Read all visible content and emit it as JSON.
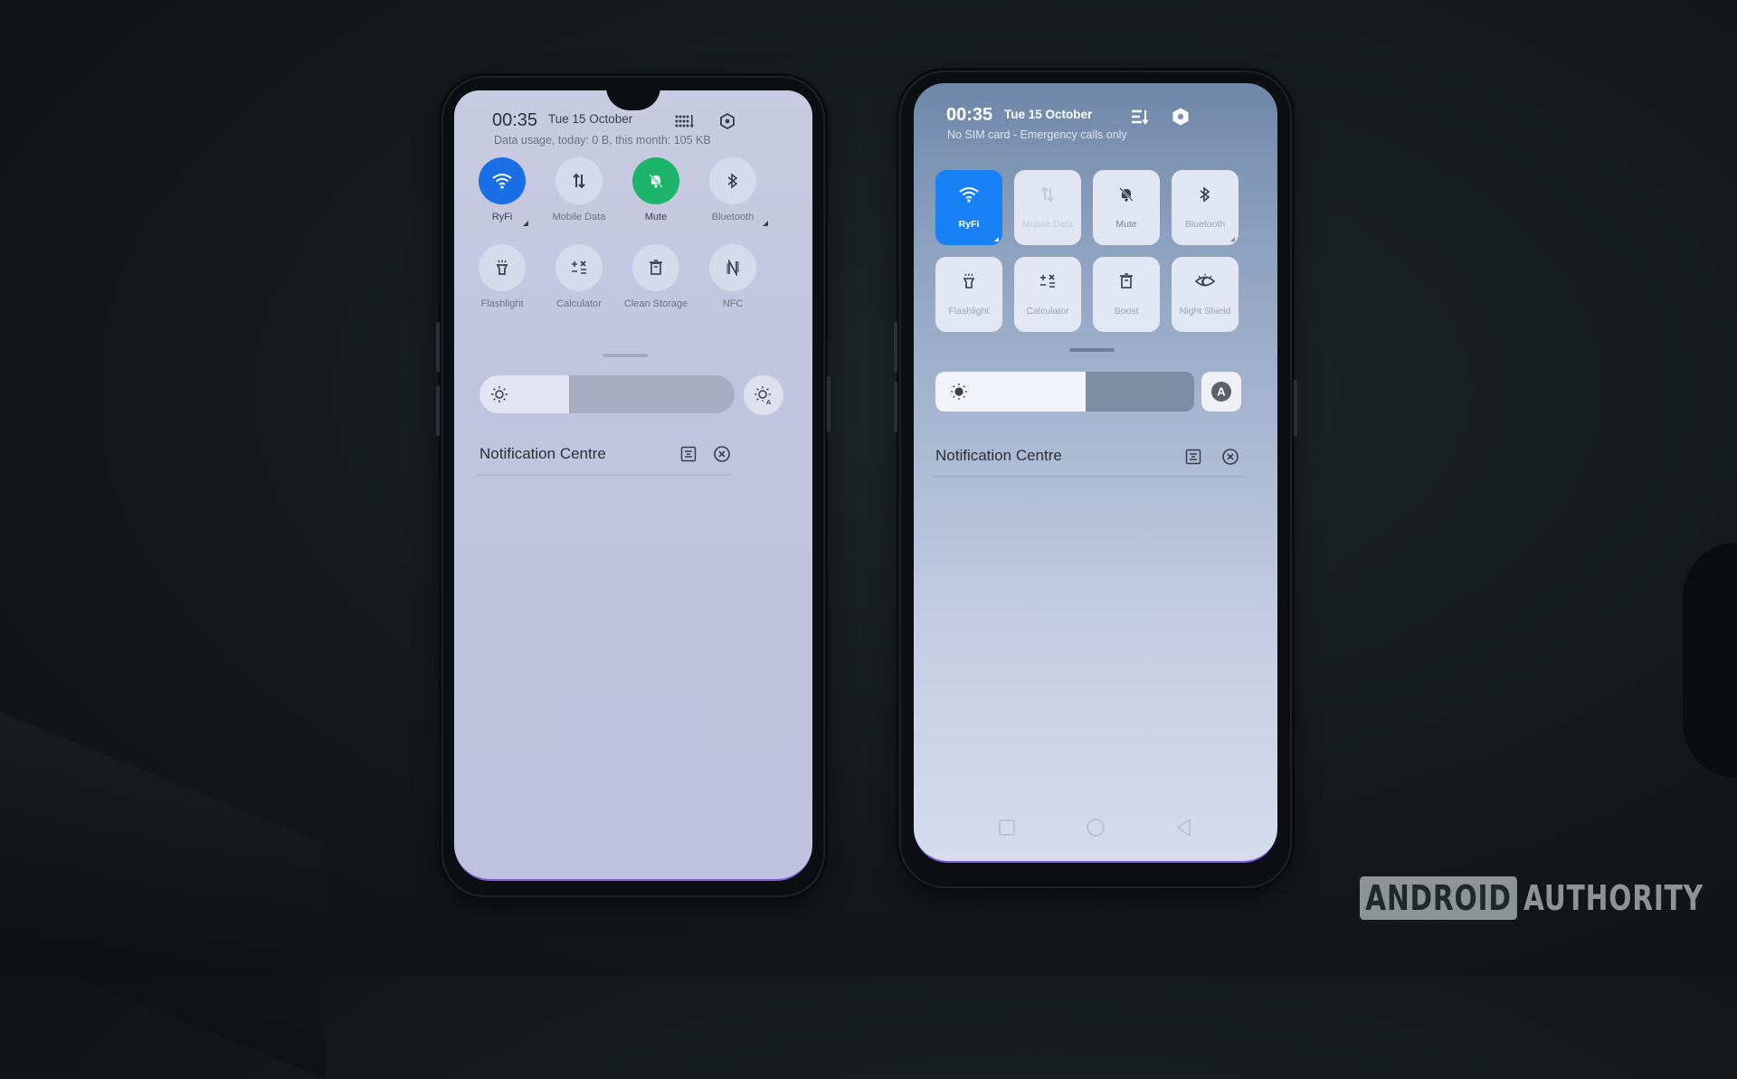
{
  "left_phone": {
    "status": {
      "time": "00:35",
      "date": "Tue 15 October",
      "subtitle": "Data usage, today: 0 B, this month: 105 KB",
      "icons": [
        "grid-edit-icon",
        "settings-icon"
      ]
    },
    "quick_tiles": [
      {
        "label": "RyFi",
        "icon": "wifi-icon",
        "state": "on",
        "color": "#1a6fe6",
        "has_expand": true
      },
      {
        "label": "Mobile Data",
        "icon": "mobile-data-icon",
        "state": "off",
        "has_expand": false
      },
      {
        "label": "Mute",
        "icon": "mute-bell-icon",
        "state": "on",
        "color": "#1db46b",
        "has_expand": false
      },
      {
        "label": "Bluetooth",
        "icon": "bluetooth-icon",
        "state": "off",
        "has_expand": true
      },
      {
        "label": "Flashlight",
        "icon": "flashlight-icon",
        "state": "off"
      },
      {
        "label": "Calculator",
        "icon": "calculator-icon",
        "state": "off"
      },
      {
        "label": "Clean Storage",
        "icon": "trash-icon",
        "state": "off"
      },
      {
        "label": "NFC",
        "icon": "nfc-icon",
        "state": "off"
      }
    ],
    "brightness": {
      "level_percent": 35,
      "auto_icon": "auto-brightness-icon"
    },
    "notification_centre": {
      "title": "Notification Centre",
      "icons": [
        "manage-icon",
        "clear-all-icon"
      ]
    }
  },
  "right_phone": {
    "status": {
      "time": "00:35",
      "date": "Tue 15 October",
      "subtitle": "No SIM card - Emergency calls only",
      "icons": [
        "sort-icon",
        "settings-icon"
      ]
    },
    "quick_tiles": [
      {
        "label": "RyFi",
        "icon": "wifi-icon",
        "state": "on",
        "color": "#1781f5"
      },
      {
        "label": "Mobile Data",
        "icon": "mobile-data-icon",
        "state": "disabled"
      },
      {
        "label": "Mute",
        "icon": "mute-bell-icon",
        "state": "off"
      },
      {
        "label": "Bluetooth",
        "icon": "bluetooth-icon",
        "state": "off"
      },
      {
        "label": "Flashlight",
        "icon": "flashlight-icon",
        "state": "off"
      },
      {
        "label": "Calculator",
        "icon": "calculator-icon",
        "state": "off"
      },
      {
        "label": "Boost",
        "icon": "trash-icon",
        "state": "off"
      },
      {
        "label": "Night Shield",
        "icon": "eye-icon",
        "state": "off"
      }
    ],
    "brightness": {
      "level_percent": 58,
      "auto_label": "A"
    },
    "notification_centre": {
      "title": "Notification Centre",
      "icons": [
        "manage-icon",
        "clear-all-icon"
      ]
    },
    "nav_bar": [
      "recents-button",
      "home-button",
      "back-button"
    ]
  },
  "watermark": {
    "boxed": "ANDROID",
    "plain": "AUTHORITY"
  }
}
